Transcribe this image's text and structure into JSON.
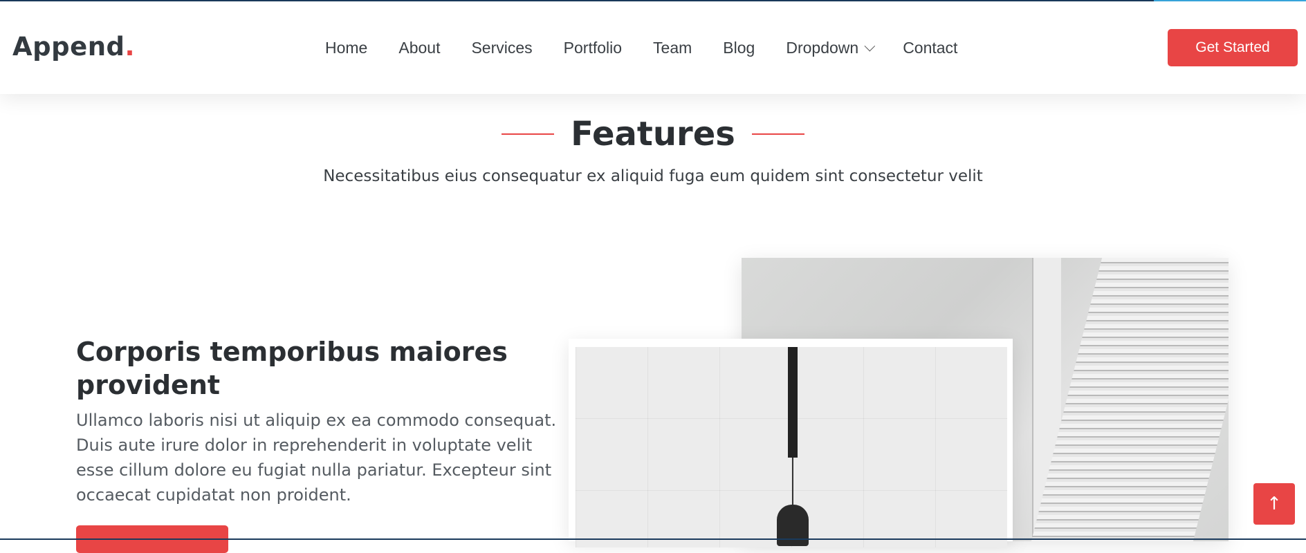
{
  "brand": {
    "name": "Append",
    "dot": "."
  },
  "nav": {
    "items": [
      "Home",
      "About",
      "Services",
      "Portfolio",
      "Team",
      "Blog",
      "Dropdown",
      "Contact"
    ],
    "cta": "Get Started"
  },
  "section": {
    "title": "Features",
    "subtitle": "Necessitatibus eius consequatur ex aliquid fuga eum quidem sint consectetur velit"
  },
  "feature": {
    "heading": "Corporis temporibus maiores provident",
    "text": "Ullamco laboris nisi ut aliquip ex ea commodo consequat. Duis aute irure dolor in reprehenderit in voluptate velit esse cillum dolore eu fugiat nulla pariatur. Excepteur sint occaecat cupidatat non proident."
  },
  "icons": {
    "dropdown": "chevron-down-icon",
    "scroll_top": "arrow-up-icon"
  },
  "colors": {
    "accent": "#e84545",
    "text": "#2b2f33",
    "muted": "#555b61"
  }
}
